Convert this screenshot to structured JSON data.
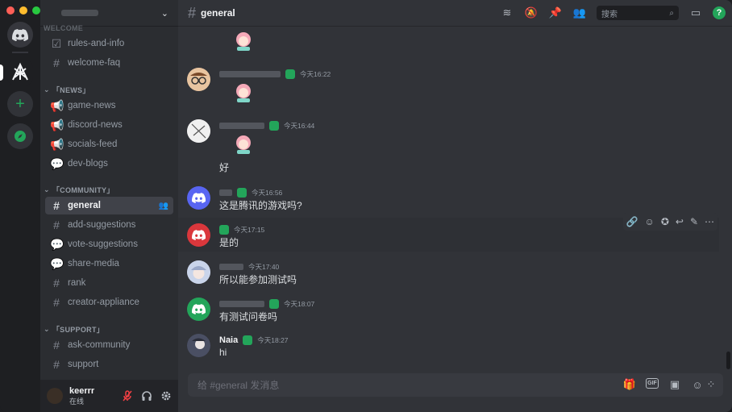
{
  "rail": {
    "home_label": "",
    "add_label": "+"
  },
  "server": {
    "name_hidden": true,
    "chevron": "⌄"
  },
  "categories": {
    "welcome": "WELCOME",
    "news": "「NEWS」",
    "community": "「COMMUNITY」",
    "support": "「SUPPORT」"
  },
  "channels": {
    "rules": "rules-and-info",
    "welcome_faq": "welcome-faq",
    "game_news": "game-news",
    "discord_news": "discord-news",
    "socials_feed": "socials-feed",
    "dev_blogs": "dev-blogs",
    "general": "general",
    "add_suggestions": "add-suggestions",
    "vote_suggestions": "vote-suggestions",
    "share_media": "share-media",
    "rank": "rank",
    "creator_appliance": "creator-appliance",
    "ask_community": "ask-community",
    "support": "support"
  },
  "user": {
    "name": "keerrr",
    "status": "在线"
  },
  "topbar": {
    "channel": "general",
    "search_placeholder": "搜索"
  },
  "messages": [
    {
      "time": "今天16:22",
      "text": ""
    },
    {
      "time": "今天16:44",
      "text": "好"
    },
    {
      "time": "今天16:56",
      "text": "这是腾讯的游戏吗?"
    },
    {
      "time": "今天17:15",
      "text": "是的"
    },
    {
      "time": "今天17:40",
      "text": "所以能参加测试吗"
    },
    {
      "time": "今天18:07",
      "text": "有测试问卷吗"
    },
    {
      "name": "Naia",
      "time": "今天18:27",
      "text": "hi"
    }
  ],
  "composer": {
    "placeholder": "给 #general 发消息",
    "gif": "GIF"
  },
  "colors": {
    "accent": "#5865f2",
    "green": "#23a55a",
    "red": "#da373c",
    "bg": "#313338",
    "sidebar": "#2b2d31"
  }
}
